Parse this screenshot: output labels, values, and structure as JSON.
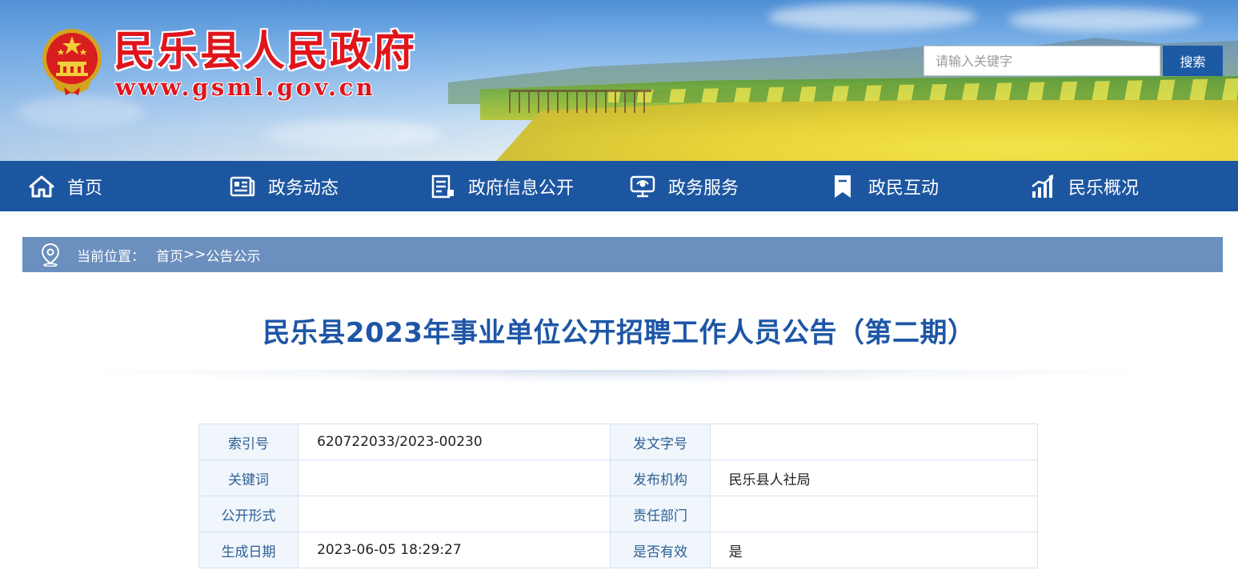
{
  "header": {
    "site_name": "民乐县人民政府",
    "site_url": "www.gsml.gov.cn",
    "search": {
      "placeholder": "请输入关键字",
      "value": "",
      "button_label": "搜索"
    }
  },
  "nav": {
    "items": [
      {
        "label": "首页",
        "icon": "home-icon"
      },
      {
        "label": "政务动态",
        "icon": "news-icon"
      },
      {
        "label": "政府信息公开",
        "icon": "document-list-icon"
      },
      {
        "label": "政务服务",
        "icon": "monitor-service-icon"
      },
      {
        "label": "政民互动",
        "icon": "bookmark-icon"
      },
      {
        "label": "民乐概况",
        "icon": "bar-chart-icon"
      }
    ]
  },
  "breadcrumb": {
    "prefix": "当前位置：",
    "home": "首页",
    "separator": ">>",
    "current": "公告公示"
  },
  "article": {
    "title": "民乐县2023年事业单位公开招聘工作人员公告（第二期）"
  },
  "meta": {
    "rows": [
      {
        "label1": "索引号",
        "value1": "620722033/2023-00230",
        "label2": "发文字号",
        "value2": ""
      },
      {
        "label1": "关键词",
        "value1": "",
        "label2": "发布机构",
        "value2": "民乐县人社局"
      },
      {
        "label1": "公开形式",
        "value1": "",
        "label2": "责任部门",
        "value2": ""
      },
      {
        "label1": "生成日期",
        "value1": "2023-06-05 18:29:27",
        "label2": "是否有效",
        "value2": "是"
      }
    ]
  },
  "colors": {
    "nav_bg": "#1d56a0",
    "breadcrumb_bg": "#6b8fbe",
    "title": "#1e56a6",
    "site_name_red": "#e0151c",
    "search_button": "#1d5aa5"
  }
}
